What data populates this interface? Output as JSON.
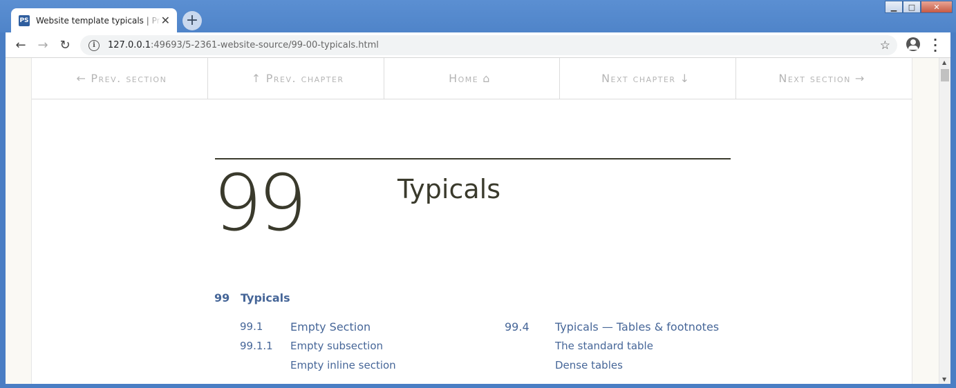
{
  "browser": {
    "tab": {
      "favicon": "PS",
      "title": "Website template typicals | Practical Typography",
      "close": "✕"
    },
    "new_tab": "+",
    "window_controls": {
      "minimize": "▁",
      "maximize": "□",
      "close": "✕"
    },
    "url_host": "127.0.0.1",
    "url_rest": ":49693/5-2361-website-source/99-00-typicals.html",
    "icons": {
      "back": "arrow-left-icon",
      "forward": "arrow-right-icon",
      "reload": "reload-icon",
      "info": "info-icon",
      "star": "star-icon",
      "profile": "profile-icon",
      "menu": "kebab-menu-icon"
    }
  },
  "pagenav": {
    "prev_section": "Prev. section",
    "prev_chapter": "Prev. chapter",
    "home": "Home",
    "next_chapter": "Next chapter",
    "next_section": "Next section"
  },
  "chapter": {
    "number": "99",
    "title": "Typicals"
  },
  "toc": {
    "main": {
      "num": "99",
      "label": "Typicals"
    },
    "left": [
      {
        "num": "99.1",
        "label": "Empty Section"
      },
      {
        "num": "99.1.1",
        "label": "Empty subsection"
      },
      {
        "num": "",
        "label": "Empty inline section"
      }
    ],
    "right": [
      {
        "num": "99.4",
        "label": "Typicals — Tables & footnotes"
      },
      {
        "num": "",
        "label": "The standard table"
      },
      {
        "num": "",
        "label": "Dense tables"
      }
    ]
  },
  "colors": {
    "link": "#466698",
    "text": "#3a3a2c",
    "nav": "#b5b5b5"
  }
}
